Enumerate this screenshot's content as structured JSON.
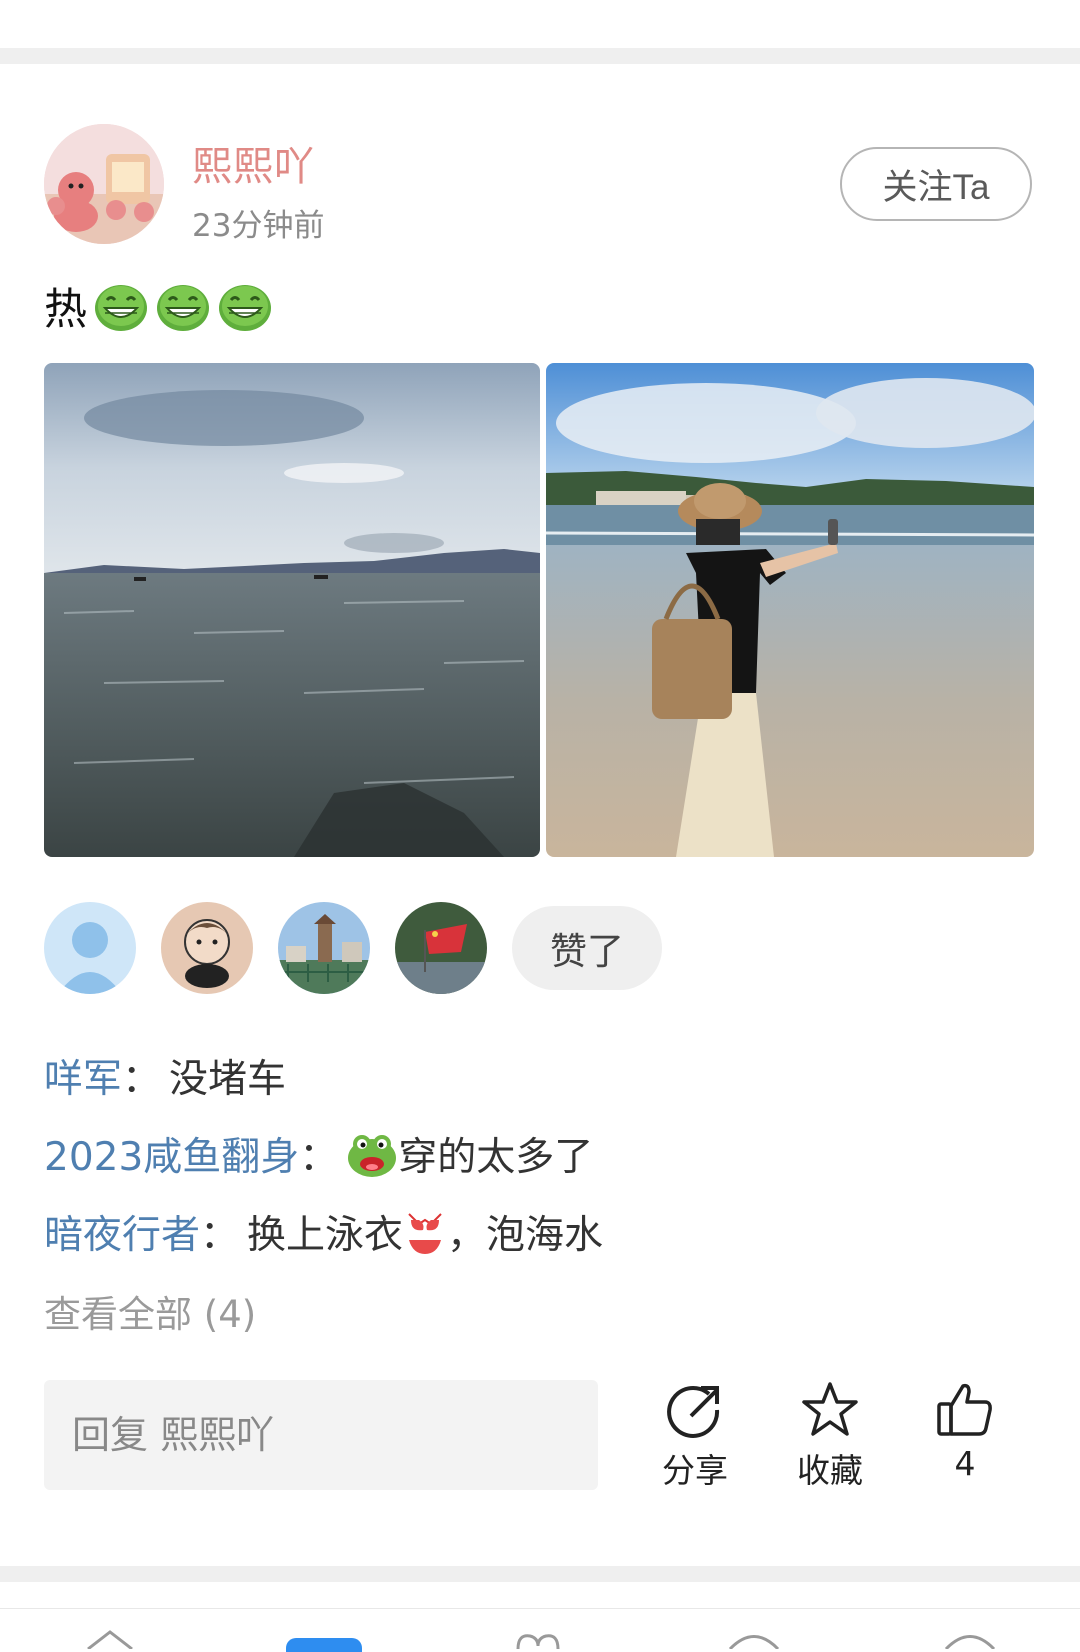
{
  "post": {
    "author_name": "熙熙吖",
    "time_ago": "23分钟前",
    "follow_label": "关注Ta",
    "text": "热",
    "emoji_icons": [
      "grin-face-icon",
      "grin-face-icon",
      "grin-face-icon"
    ]
  },
  "photos": [
    {
      "name": "sea-photo"
    },
    {
      "name": "beach-selfie-photo"
    }
  ],
  "likes": {
    "liked_label": "赞了"
  },
  "comments": [
    {
      "user": "咩军",
      "sep": "：",
      "text": "没堵车"
    },
    {
      "user": "2023咸鱼翻身",
      "sep": "：",
      "text": "穿的太多了"
    },
    {
      "user": "暗夜行者",
      "sep": "：",
      "text_before": "换上泳衣",
      "text_after": "，泡海水"
    }
  ],
  "view_all": "查看全部 (4)",
  "reply": {
    "placeholder": "回复 熙熙吖"
  },
  "actions": {
    "share_label": "分享",
    "favorite_label": "收藏",
    "like_count": "4"
  },
  "colors": {
    "author_name": "#e08a86",
    "comment_user": "#4f7fb0",
    "divider": "#efefef"
  }
}
